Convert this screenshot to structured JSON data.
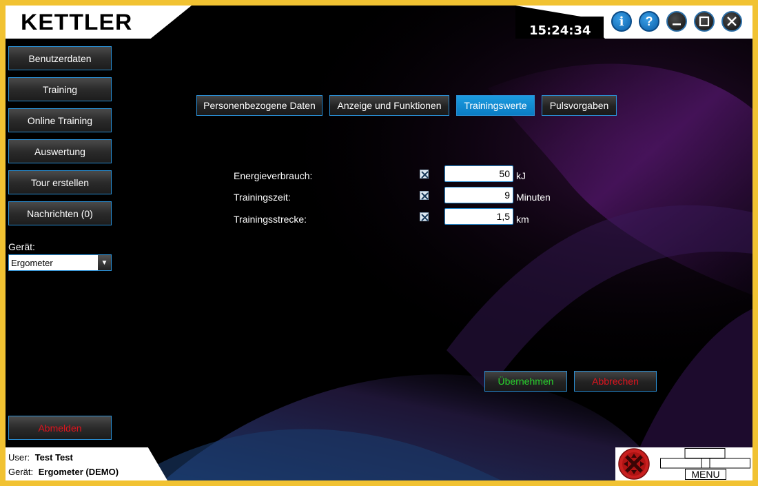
{
  "header": {
    "brand": "KETTLER",
    "clock": "15:24:34"
  },
  "window_buttons": {
    "info": "i",
    "help": "?"
  },
  "sidebar": {
    "items": [
      {
        "label": "Benutzerdaten"
      },
      {
        "label": "Training"
      },
      {
        "label": "Online Training"
      },
      {
        "label": "Auswertung"
      },
      {
        "label": "Tour erstellen"
      },
      {
        "label": "Nachrichten (0)"
      }
    ],
    "device_label": "Gerät:",
    "device_value": "Ergometer",
    "logout_label": "Abmelden"
  },
  "tabs": [
    {
      "label": "Personenbezogene Daten"
    },
    {
      "label": "Anzeige und Funktionen"
    },
    {
      "label": "Trainingswerte",
      "active": true
    },
    {
      "label": "Pulsvorgaben"
    }
  ],
  "form": {
    "rows": [
      {
        "label": "Energieverbrauch:",
        "checked": true,
        "value": "50",
        "unit": "kJ"
      },
      {
        "label": "Trainingszeit:",
        "checked": true,
        "value": "9",
        "unit": "Minuten"
      },
      {
        "label": "Trainingsstrecke:",
        "checked": true,
        "value": "1,5",
        "unit": "km"
      }
    ]
  },
  "actions": {
    "apply": "Übernehmen",
    "cancel": "Abbrechen"
  },
  "footer": {
    "user_label": "User:",
    "user_value": "Test Test",
    "device_label": "Gerät:",
    "device_value": "Ergometer (DEMO)",
    "menu_label": "MENU"
  },
  "colors": {
    "accent": "#2a8fd4",
    "active_tab": "#0a7cc4",
    "frame": "#f1c232",
    "apply": "#29d32d",
    "cancel": "#e0141e"
  }
}
